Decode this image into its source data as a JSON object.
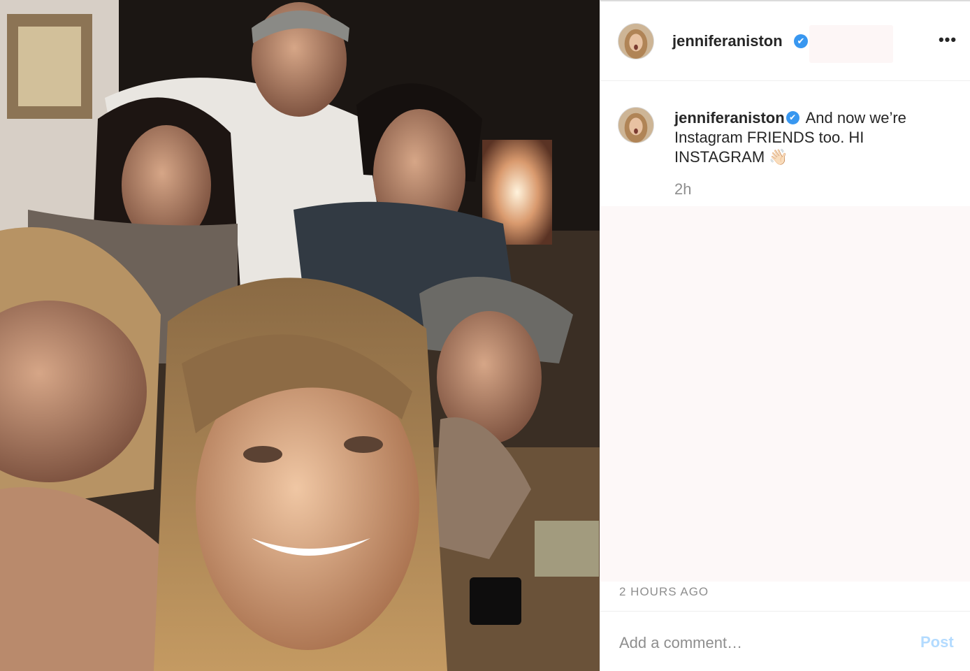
{
  "post": {
    "image_alt": "Group selfie of six friends in a dimly lit living room"
  },
  "header": {
    "username": "jenniferaniston",
    "verified_glyph": "✔",
    "more_label": "•••"
  },
  "caption": {
    "username": "jenniferaniston",
    "verified_glyph": "✔",
    "text": "And now we’re Instagram FRIENDS too. HI INSTAGRAM",
    "emoji": "👋🏻",
    "time": "2h"
  },
  "footer": {
    "timestamp": "2 HOURS AGO",
    "comment_placeholder": "Add a comment…",
    "post_label": "Post"
  },
  "colors": {
    "verified": "#3897f0",
    "post_disabled": "#b3dbff",
    "muted_text": "#8e8e8e"
  },
  "icons": [
    "verified-badge-icon",
    "more-options-icon"
  ]
}
